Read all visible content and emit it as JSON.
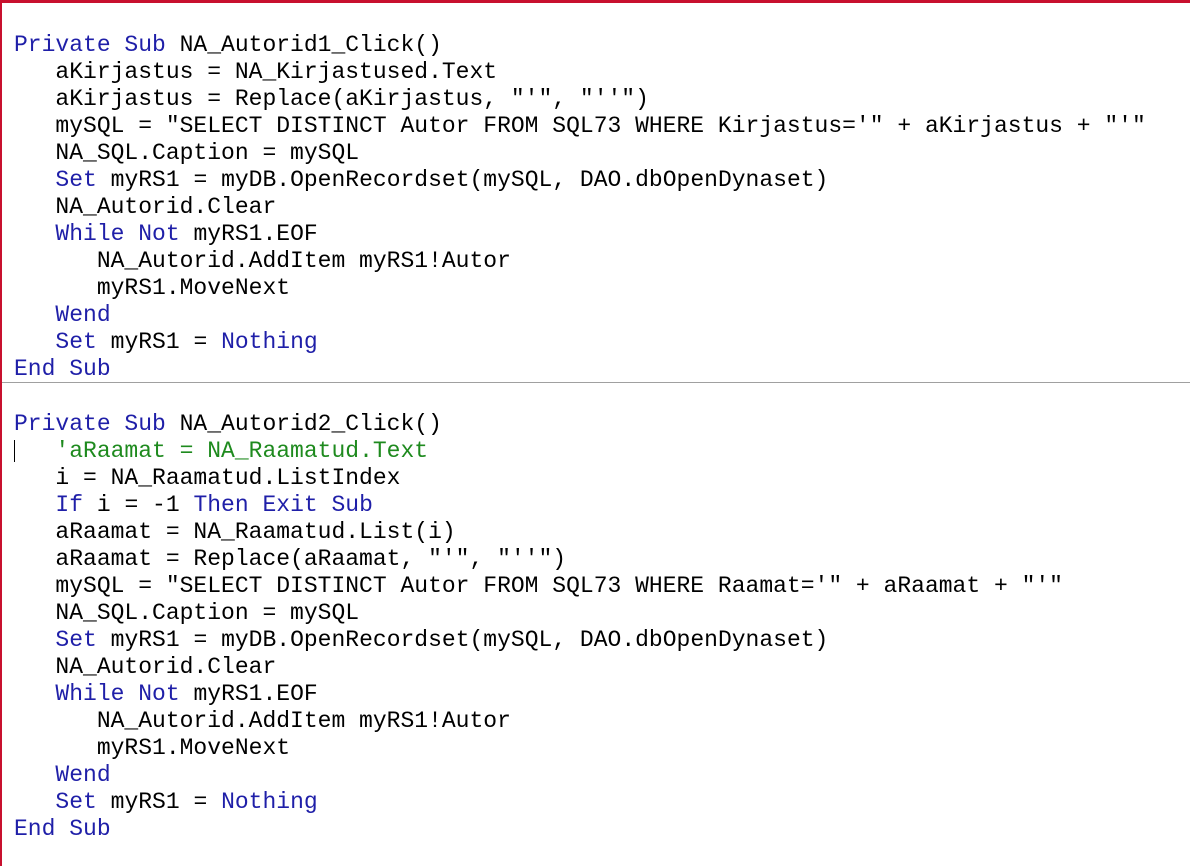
{
  "colors": {
    "keyword": "#1f1fa8",
    "comment": "#1e8a1e",
    "text": "#000000",
    "border": "#c8102e",
    "separator": "#a0a0a0"
  },
  "procedures": [
    {
      "lines": [
        [
          {
            "t": "Private Sub",
            "c": "kw"
          },
          {
            "t": " NA_Autorid1_Click()",
            "c": ""
          }
        ],
        [
          {
            "t": "   aKirjastus = NA_Kirjastused.Text",
            "c": ""
          }
        ],
        [
          {
            "t": "   aKirjastus = Replace(aKirjastus, \"'\", \"''\")",
            "c": ""
          }
        ],
        [
          {
            "t": "   mySQL = \"SELECT DISTINCT Autor FROM SQL73 WHERE Kirjastus='\" + aKirjastus + \"'\"",
            "c": ""
          }
        ],
        [
          {
            "t": "   NA_SQL.Caption = mySQL",
            "c": ""
          }
        ],
        [
          {
            "t": "   ",
            "c": ""
          },
          {
            "t": "Set",
            "c": "kw"
          },
          {
            "t": " myRS1 = myDB.OpenRecordset(mySQL, DAO.dbOpenDynaset)",
            "c": ""
          }
        ],
        [
          {
            "t": "   NA_Autorid.Clear",
            "c": ""
          }
        ],
        [
          {
            "t": "   ",
            "c": ""
          },
          {
            "t": "While Not",
            "c": "kw"
          },
          {
            "t": " myRS1.EOF",
            "c": ""
          }
        ],
        [
          {
            "t": "      NA_Autorid.AddItem myRS1!Autor",
            "c": ""
          }
        ],
        [
          {
            "t": "      myRS1.MoveNext",
            "c": ""
          }
        ],
        [
          {
            "t": "   ",
            "c": ""
          },
          {
            "t": "Wend",
            "c": "kw"
          }
        ],
        [
          {
            "t": "   ",
            "c": ""
          },
          {
            "t": "Set",
            "c": "kw"
          },
          {
            "t": " myRS1 = ",
            "c": ""
          },
          {
            "t": "Nothing",
            "c": "kw"
          }
        ],
        [
          {
            "t": "End Sub",
            "c": "kw"
          }
        ]
      ]
    },
    {
      "lines": [
        [
          {
            "t": "Private Sub",
            "c": "kw"
          },
          {
            "t": " NA_Autorid2_Click()",
            "c": ""
          }
        ],
        [
          {
            "t": "   ",
            "c": ""
          },
          {
            "t": "'aRaamat = NA_Raamatud.Text",
            "c": "cm"
          }
        ],
        [
          {
            "t": "   i = NA_Raamatud.ListIndex",
            "c": ""
          }
        ],
        [
          {
            "t": "   ",
            "c": ""
          },
          {
            "t": "If",
            "c": "kw"
          },
          {
            "t": " i = -1 ",
            "c": ""
          },
          {
            "t": "Then Exit Sub",
            "c": "kw"
          }
        ],
        [
          {
            "t": "   aRaamat = NA_Raamatud.List(i)",
            "c": ""
          }
        ],
        [
          {
            "t": "   aRaamat = Replace(aRaamat, \"'\", \"''\")",
            "c": ""
          }
        ],
        [
          {
            "t": "   mySQL = \"SELECT DISTINCT Autor FROM SQL73 WHERE Raamat='\" + aRaamat + \"'\"",
            "c": ""
          }
        ],
        [
          {
            "t": "   NA_SQL.Caption = mySQL",
            "c": ""
          }
        ],
        [
          {
            "t": "   ",
            "c": ""
          },
          {
            "t": "Set",
            "c": "kw"
          },
          {
            "t": " myRS1 = myDB.OpenRecordset(mySQL, DAO.dbOpenDynaset)",
            "c": ""
          }
        ],
        [
          {
            "t": "   NA_Autorid.Clear",
            "c": ""
          }
        ],
        [
          {
            "t": "   ",
            "c": ""
          },
          {
            "t": "While Not",
            "c": "kw"
          },
          {
            "t": " myRS1.EOF",
            "c": ""
          }
        ],
        [
          {
            "t": "      NA_Autorid.AddItem myRS1!Autor",
            "c": ""
          }
        ],
        [
          {
            "t": "      myRS1.MoveNext",
            "c": ""
          }
        ],
        [
          {
            "t": "   ",
            "c": ""
          },
          {
            "t": "Wend",
            "c": "kw"
          }
        ],
        [
          {
            "t": "   ",
            "c": ""
          },
          {
            "t": "Set",
            "c": "kw"
          },
          {
            "t": " myRS1 = ",
            "c": ""
          },
          {
            "t": "Nothing",
            "c": "kw"
          }
        ],
        [
          {
            "t": "End Sub",
            "c": "kw"
          }
        ]
      ]
    }
  ]
}
